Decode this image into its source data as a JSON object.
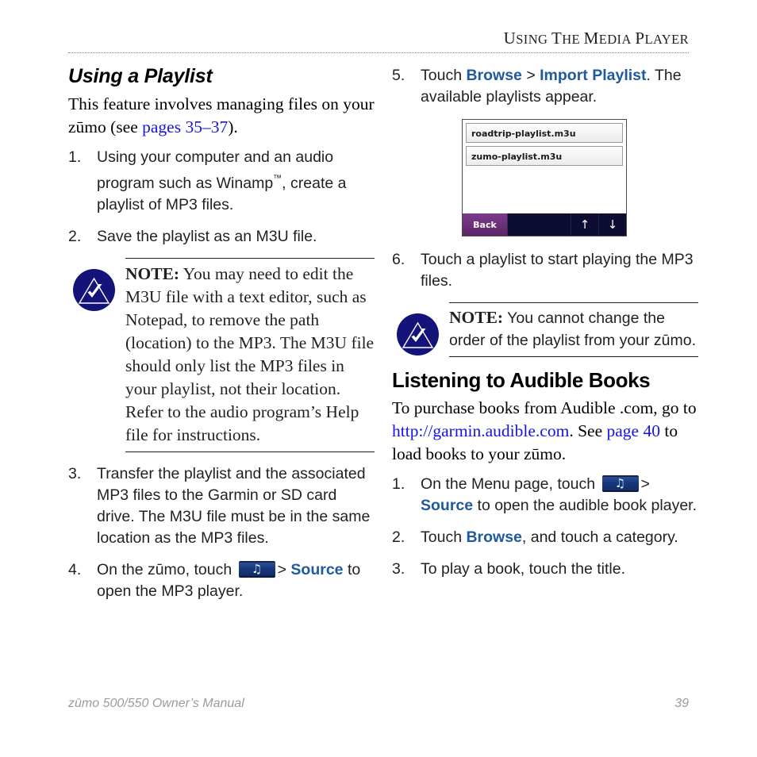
{
  "header": {
    "running_title_words": [
      "Using",
      "the",
      "Media",
      "Player"
    ],
    "running_title": "Using the Media Player"
  },
  "left_column": {
    "heading": "Using a Playlist",
    "intro": {
      "before_link": "This feature involves managing files on your zūmo (see ",
      "link": "pages 35–37",
      "after_link": ")."
    },
    "steps": [
      {
        "num": "1.",
        "before_tm": "Using your computer and an audio program such as Winamp",
        "tm": "™",
        "after_tm": ", create a playlist of MP3 files."
      },
      {
        "num": "2.",
        "text": "Save the playlist as an M3U file."
      },
      {
        "num": "3.",
        "text": "Transfer the playlist and the associated MP3 files to the Garmin or SD card drive. The M3U file must be in the same location as the MP3 files."
      },
      {
        "num": "4.",
        "text_before_icon": "On the zūmo, touch ",
        "icon": "music-note-button",
        "separator": ">",
        "ui_word": "Source",
        "text_after": " to open the MP3 player."
      }
    ],
    "note": {
      "label": "NOTE:",
      "text": " You may need to edit the M3U file with a text editor, such as Notepad, to remove the path (location) to the MP3. The M3U file should only list the MP3 files in your playlist, not their location. Refer to the audio program’s Help file for instructions.",
      "icon": "note-warning-icon"
    }
  },
  "right_column": {
    "steps_top": [
      {
        "num": "5.",
        "text_before": "Touch ",
        "ui_word_1": "Browse",
        "separator": " > ",
        "ui_word_2": "Import Playlist",
        "text_after": ". The available playlists appear."
      },
      {
        "num": "6.",
        "text": "Touch a playlist to start playing the MP3 files."
      }
    ],
    "device_screenshot": {
      "name": "zumo-playlist-screen",
      "playlists": [
        "roadtrip-playlist.m3u",
        "zumo-playlist.m3u"
      ],
      "back_label": "Back",
      "arrow_up": "↑",
      "arrow_down": "↓"
    },
    "note": {
      "label": "NOTE:",
      "text": " You cannot change the order of the playlist from your zūmo.",
      "icon": "note-warning-icon"
    },
    "heading": "Listening to Audible Books",
    "intro": {
      "part1": "To purchase books from Audible .com, go to ",
      "link1": "http://garmin.audible.com",
      "part2": ". See ",
      "link2": "page 40",
      "part3": " to load books to your zūmo."
    },
    "steps_bottom": [
      {
        "num": "1.",
        "text_before_icon": "On the Menu page, touch ",
        "icon": "music-note-button",
        "separator": ">",
        "ui_word": "Source",
        "text_after": " to open the audible book player."
      },
      {
        "num": "2.",
        "text_before": "Touch ",
        "ui_word": "Browse",
        "text_after": ", and touch a category."
      },
      {
        "num": "3.",
        "text": "To play a book, touch the title."
      }
    ]
  },
  "footer": {
    "manual_title": "zūmo 500/550 Owner’s Manual",
    "page_number": "39"
  },
  "colors": {
    "serif_link": "#1414e6",
    "ui_bold": "#1f5a9c",
    "note_icon_navy": "#131379",
    "device_bar": "#0d0d33",
    "device_back_purple": "#6d2f7d",
    "footer_gray": "#9b9b9b"
  }
}
